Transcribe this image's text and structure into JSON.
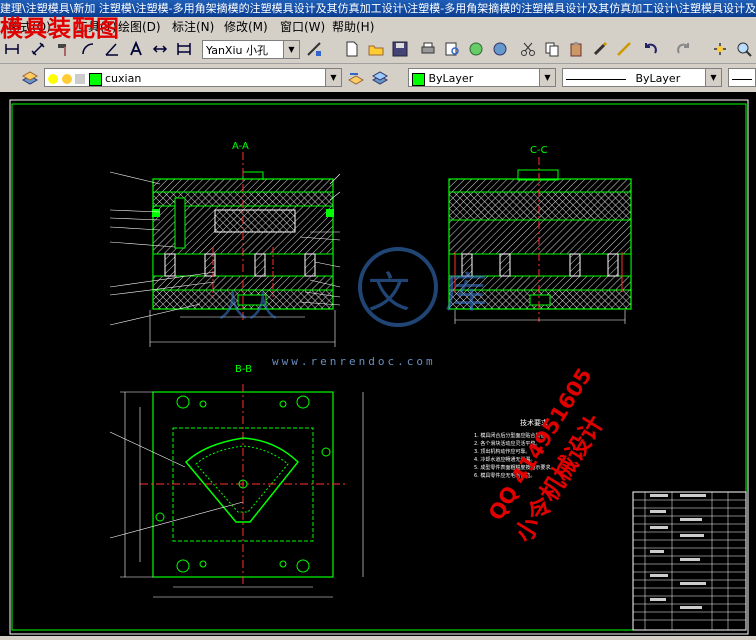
{
  "window": {
    "title": "建理\\注塑模具\\新加 注塑模\\注塑模-多用角架摘模的注塑模具设计及其仿真加工设计\\注塑模-多用角架摘模的注塑模具设计及其仿真加工设计\\注塑模具设计及其仿真加工设计"
  },
  "overlay": {
    "title": "模具装配图",
    "watermark_site": "www.renrendoc.com",
    "contact_qq": "QQ 414951605",
    "contact_name": "小令机械设计"
  },
  "menu": {
    "items": [
      "格式(O)",
      "工具(T)",
      "绘图(D)",
      "标注(N)",
      "修改(M)",
      "窗口(W)",
      "帮助(H)"
    ]
  },
  "toolbar": {
    "text_style": "YanXiu 小孔",
    "layer": "cuxian",
    "color": "ByLayer",
    "linetype": "ByLayer"
  },
  "drawing": {
    "section_aa": "A-A",
    "section_cc": "C-C",
    "section_bb": "B-B",
    "tech_req_title": "技术要求",
    "tech_req_lines": [
      "1. 模具闭合后分型面应贴合紧密。",
      "2. 各个滑块活动应灵活平稳。",
      "3. 顶出机构动作应可靠。",
      "4. 冷却水道应畅通无泄漏。",
      "5. 成型零件表面粗糙度按图示要求。",
      "6. 模具零件应无毛刺锐边。"
    ]
  },
  "colors": {
    "background": "#000000",
    "frame": "#00ff00",
    "hatch": "#ffffff",
    "centerline": "#ff3030",
    "text_red": "#e00000"
  }
}
